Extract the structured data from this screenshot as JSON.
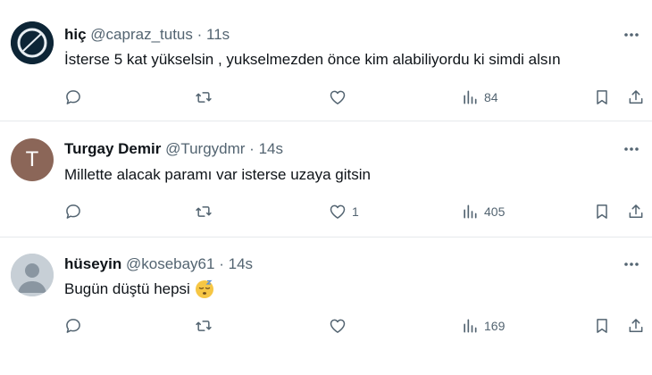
{
  "tweets": [
    {
      "name": "hiç",
      "handle": "@capraz_tutus",
      "separator": "·",
      "time": "11s",
      "text": "İsterse 5 kat yükselsin , yukselmezden önce kim alabiliyordu ki simdi alsın",
      "avatar": "logo-avatar",
      "likes": "",
      "views": "84"
    },
    {
      "name": "Turgay Demir",
      "handle": "@Turgydmr",
      "separator": "·",
      "time": "14s",
      "text": "Millette alacak paramı var isterse uzaya gitsin",
      "avatar": "letter-avatar",
      "avatar_letter": "T",
      "likes": "1",
      "views": "405"
    },
    {
      "name": "hüseyin",
      "handle": "@kosebay61",
      "separator": "·",
      "time": "14s",
      "text": "Bugün düştü hepsi",
      "emoji": "sleeping-face-emoji",
      "avatar": "default-avatar",
      "likes": "",
      "views": "169"
    }
  ],
  "colors": {
    "text_primary": "#0f1419",
    "text_secondary": "#536471",
    "divider": "#e6e9ec",
    "avatar_letter_bg": "#8b6658",
    "avatar_default_bg": "#c7cfd6"
  },
  "icons": [
    "reply-icon",
    "retweet-icon",
    "like-icon",
    "views-icon",
    "bookmark-icon",
    "share-icon",
    "more-icon"
  ]
}
